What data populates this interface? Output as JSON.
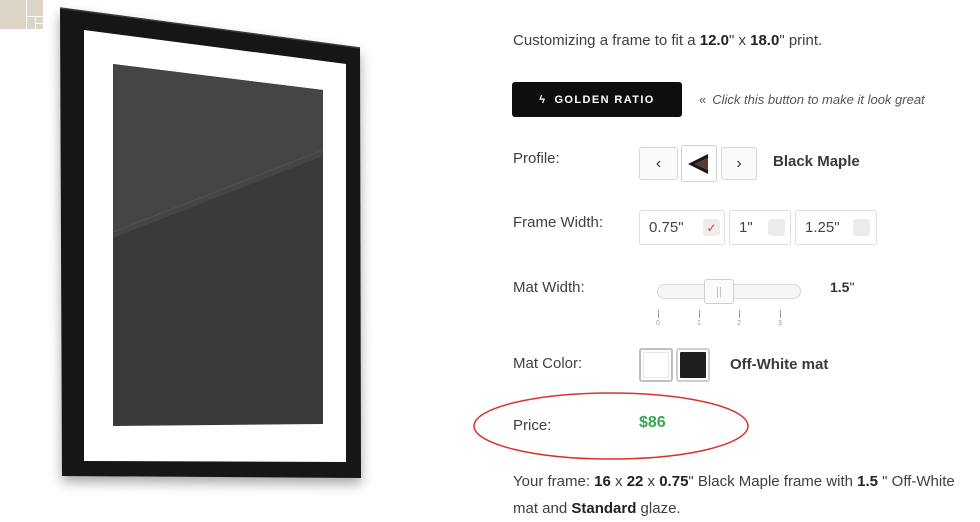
{
  "intro": {
    "text_prefix": "Customizing a frame to fit a ",
    "print_width": "12.0",
    "text_x": "\" x ",
    "print_height": "18.0",
    "text_suffix": "\" print."
  },
  "golden_ratio": {
    "label": "GOLDEN RATIO",
    "hint": "Click this button to make it look great"
  },
  "profile": {
    "label": "Profile:",
    "name": "Black Maple",
    "prev_glyph": "‹",
    "next_glyph": "›",
    "icon": "profile-corner-icon"
  },
  "frame_width": {
    "label": "Frame Width:",
    "options": [
      {
        "label": "0.75\"",
        "selected": true
      },
      {
        "label": "1\"",
        "selected": false
      },
      {
        "label": "1.25\"",
        "selected": false
      }
    ]
  },
  "mat_width": {
    "label": "Mat Width:",
    "value": "1.5",
    "unit": "\"",
    "tick_labels": [
      "0",
      "1",
      "2",
      "3"
    ],
    "slider_fraction": 0.42
  },
  "mat_color": {
    "label": "Mat Color:",
    "name": "Off-White mat",
    "swatches": [
      {
        "name": "off-white",
        "color": "#ffffff",
        "selected": true
      },
      {
        "name": "black",
        "color": "#1f1f1f",
        "selected": false
      }
    ]
  },
  "price": {
    "label": "Price:",
    "value": "$86",
    "color": "#3aa655",
    "annotation_color": "#d9322c"
  },
  "summary": {
    "prefix": "Your frame: ",
    "w": "16",
    "x1": " x ",
    "h": "22",
    "x2": " x ",
    "d": "0.75",
    "mid": "\" Black Maple frame with ",
    "mat": "1.5",
    "mid2": " \" Off-White mat and ",
    "glaze": "Standard",
    "suffix": " glaze."
  },
  "colors": {
    "frame": "#151515",
    "artwork": "#3a3a3a",
    "mat": "#ffffff",
    "button": "#0e0e0e"
  }
}
